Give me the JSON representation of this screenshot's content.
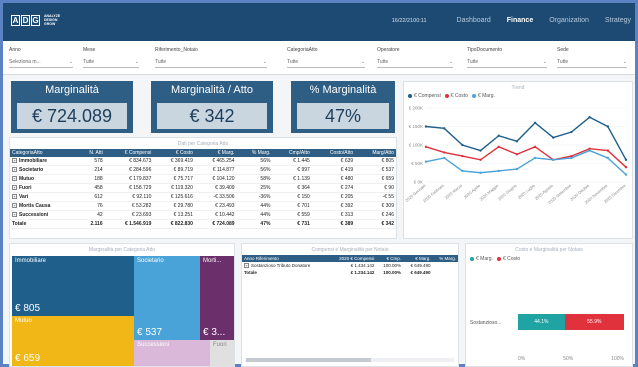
{
  "header": {
    "logo_letters": [
      "A",
      "D",
      "G"
    ],
    "logo_text_1": "ANALYZE",
    "logo_text_2": "DESIGN",
    "logo_text_3": "GROW",
    "date": "16/22/2100:11",
    "tabs": [
      "Dashboard",
      "Finance",
      "Organization",
      "Strategy"
    ],
    "active_tab": "Finance"
  },
  "filters": [
    {
      "label": "Anno",
      "value": "Seleziona m..."
    },
    {
      "label": "Mese",
      "value": "Tutte"
    },
    {
      "label": "Riferimento_Notaio",
      "value": "Tutte"
    },
    {
      "label": "CategoriaAtto",
      "value": "Tutte"
    },
    {
      "label": "Operatore",
      "value": "Tutte"
    },
    {
      "label": "TipoDocumento",
      "value": "Tutte"
    },
    {
      "label": "Sede",
      "value": "Tutte"
    }
  ],
  "cards": [
    {
      "title": "Marginalità",
      "value": "€ 724.089"
    },
    {
      "title": "Marginalità / Atto",
      "value": "€ 342"
    },
    {
      "title": "% Marginalità",
      "value": "47%"
    }
  ],
  "dati_table": {
    "title": "Dati per Categoria Atto",
    "columns": [
      "CategoriaAtto",
      "N. Atti",
      "€ Compensi",
      "€ Costo",
      "€ Marg.",
      "% Marg.",
      "Cmp/Atto",
      "Costo/Atto",
      "Marg/Atto"
    ],
    "rows": [
      [
        "Immobiliare",
        "578",
        "€ 834.673",
        "€ 369.419",
        "€ 465.254",
        "56%",
        "€ 1.445",
        "€ 639",
        "€ 805"
      ],
      [
        "Societario",
        "214",
        "€ 284.596",
        "€ 89.719",
        "€ 114.877",
        "56%",
        "€ 997",
        "€ 419",
        "€ 537"
      ],
      [
        "Mutuo",
        "188",
        "€ 179.837",
        "€ 75.717",
        "€ 104.120",
        "58%",
        "€ 1.139",
        "€ 480",
        "€ 659"
      ],
      [
        "Fuori",
        "458",
        "€ 158.729",
        "€ 119.320",
        "€ 39.409",
        "25%",
        "€ 364",
        "€ 274",
        "€ 90"
      ],
      [
        "Vari",
        "612",
        "€ 92.110",
        "€ 125.616",
        "-€ 33.506",
        "-36%",
        "€ 150",
        "€ 205",
        "-€ 55"
      ],
      [
        "Mortis Causa",
        "76",
        "€ 53.282",
        "€ 29.780",
        "€ 23.493",
        "44%",
        "€ 701",
        "€ 392",
        "€ 309"
      ],
      [
        "Successioni",
        "42",
        "€ 23.693",
        "€ 13.251",
        "€ 10.442",
        "44%",
        "€ 559",
        "€ 313",
        "€ 246"
      ]
    ],
    "total": [
      "Totale",
      "2.116",
      "€ 1.546.919",
      "€ 822.830",
      "€ 724.089",
      "47%",
      "€ 731",
      "€ 389",
      "€ 342"
    ]
  },
  "line_chart": {
    "title": "Trend",
    "legend": [
      {
        "label": "€ Compensi",
        "color": "#1f5f8b"
      },
      {
        "label": "€ Costo",
        "color": "#e0323c"
      },
      {
        "label": "€ Marg.",
        "color": "#4aa3d8"
      }
    ],
    "y_ticks": [
      "€ 200K",
      "€ 150K",
      "€ 100K",
      "€ 50K",
      "€ 0K"
    ]
  },
  "chart_data": {
    "type": "line",
    "x": [
      "2020 Gennaio",
      "2020 Febbraio",
      "2020 Marzo",
      "2020 Aprile",
      "2020 Maggio",
      "2020 Giugno",
      "2020 Luglio",
      "2020 Agosto",
      "2020 Settembre",
      "2020 Ottobre",
      "2020 Novembre",
      "2020 Dicembre"
    ],
    "ylim": [
      0,
      200
    ],
    "series": [
      {
        "name": "€ Compensi",
        "values": [
          150,
          145,
          100,
          85,
          125,
          110,
          160,
          120,
          135,
          175,
          150,
          60
        ]
      },
      {
        "name": "€ Costo",
        "values": [
          95,
          80,
          70,
          60,
          95,
          75,
          95,
          60,
          70,
          90,
          85,
          40
        ]
      },
      {
        "name": "€ Marg.",
        "values": [
          55,
          65,
          30,
          25,
          30,
          35,
          65,
          60,
          65,
          85,
          65,
          20
        ]
      }
    ]
  },
  "treemap": {
    "title": "Marginalità per Categoria Atto",
    "tiles": [
      {
        "label": "Immobiliare",
        "value": "€ 805",
        "color": "#1f5f8b"
      },
      {
        "label": "Societario",
        "value": "€ 537",
        "color": "#4aa3d8"
      },
      {
        "label": "Morti...",
        "value": "€ 3...",
        "color": "#6b2f6b"
      },
      {
        "label": "Mutuo",
        "value": "€ 659",
        "color": "#f0b716"
      },
      {
        "label": "Successioni",
        "value": "",
        "color": "#d9b8d9"
      },
      {
        "label": "Fuori",
        "value": "",
        "color": "#e0e0e0"
      }
    ]
  },
  "summary_table": {
    "title": "Compensi e Marginalità per Notaio",
    "columns": [
      "Anno Riferimento",
      "2020 € Compensi",
      "€ Cmp.",
      "€ Marg.",
      "% Marg."
    ],
    "rows": [
      [
        "Sostanzioso Tributo Donatore",
        "€ 1.434.142",
        "100.00%",
        "€ 649.490",
        ""
      ]
    ],
    "total": [
      "Totale",
      "€ 1.234.142",
      "100.00%",
      "€ 649.490",
      ""
    ]
  },
  "stacked_bar": {
    "title": "Costo e Marginalità per Notaio",
    "legend": [
      {
        "label": "€ Marg.",
        "color": "#1fa3a3"
      },
      {
        "label": "€ Costo",
        "color": "#e0323c"
      }
    ],
    "row_label": "Sostanzioso...",
    "x_ticks": [
      "0%",
      "50%",
      "100%"
    ],
    "marg_pct": 44.1,
    "cost_pct": 55.9,
    "marg_label": "44.1%",
    "cost_label": "55.9%"
  }
}
